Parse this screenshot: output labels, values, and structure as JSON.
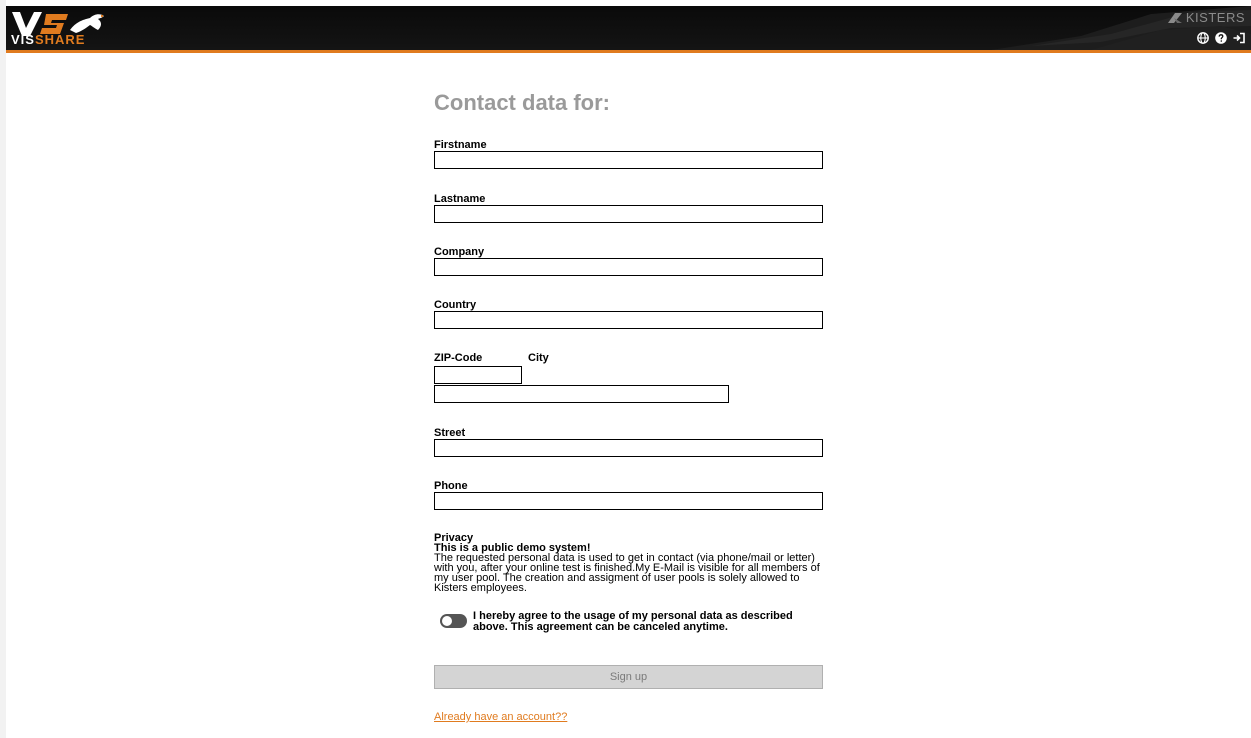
{
  "header": {
    "logo_text_a": "VIS",
    "logo_text_b": "SHARE",
    "brand": "KISTERS",
    "icons": [
      "globe-icon",
      "help-icon",
      "sign-out-icon"
    ],
    "accent_color": "#e07b1f"
  },
  "form": {
    "title": "Contact data for:",
    "firstname_label": "Firstname",
    "lastname_label": "Lastname",
    "company_label": "Company",
    "country_label": "Country",
    "zip_label": "ZIP-Code",
    "city_label": "City",
    "street_label": "Street",
    "phone_label": "Phone",
    "firstname_value": "",
    "lastname_value": "",
    "company_value": "",
    "country_value": "",
    "zip_value": "",
    "city_value": "",
    "street_value": "",
    "phone_value": ""
  },
  "privacy": {
    "heading": "Privacy",
    "subheading": "This is a public demo system!",
    "body": "The requested personal data is used to get in contact (via phone/mail or letter) with you, after your online test is finished.My E-Mail is visible for all members of my user pool. The creation and assigment of user pools is solely allowed to Kisters employees.",
    "agree_text": "I hereby agree to the usage of my personal data as described above. This agreement can be canceled anytime.",
    "agree_enabled": false
  },
  "actions": {
    "signup_label": "Sign up",
    "account_link": "Already have an account??"
  }
}
